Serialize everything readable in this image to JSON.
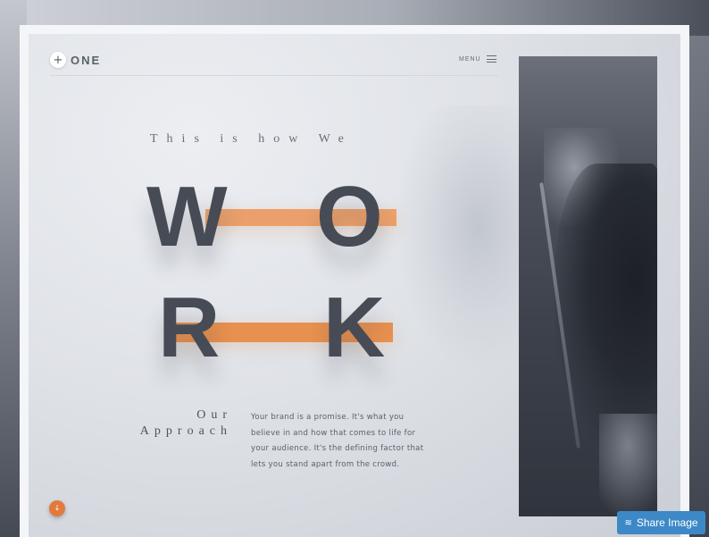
{
  "header": {
    "logo_symbol": "+",
    "logo_text": "ONE",
    "menu_label": "MENU"
  },
  "hero": {
    "tagline": "This is how We",
    "word_letters": [
      "W",
      "O",
      "R",
      "K"
    ]
  },
  "approach": {
    "title_line1": "Our",
    "title_line2": "Approach",
    "body": "Your brand is a promise. It's what you believe in and how that comes to life for your audience. It's the defining factor that lets you stand apart from the crowd."
  },
  "scroll_button": {
    "icon": "arrow-down-icon",
    "glyph": "↓"
  },
  "share_button": {
    "icon": "layers-icon",
    "glyph": "≋",
    "label": "Share Image"
  },
  "colors": {
    "accent": "#e8904f",
    "text_dark": "#474b55",
    "share_blue": "#3d89c7"
  }
}
